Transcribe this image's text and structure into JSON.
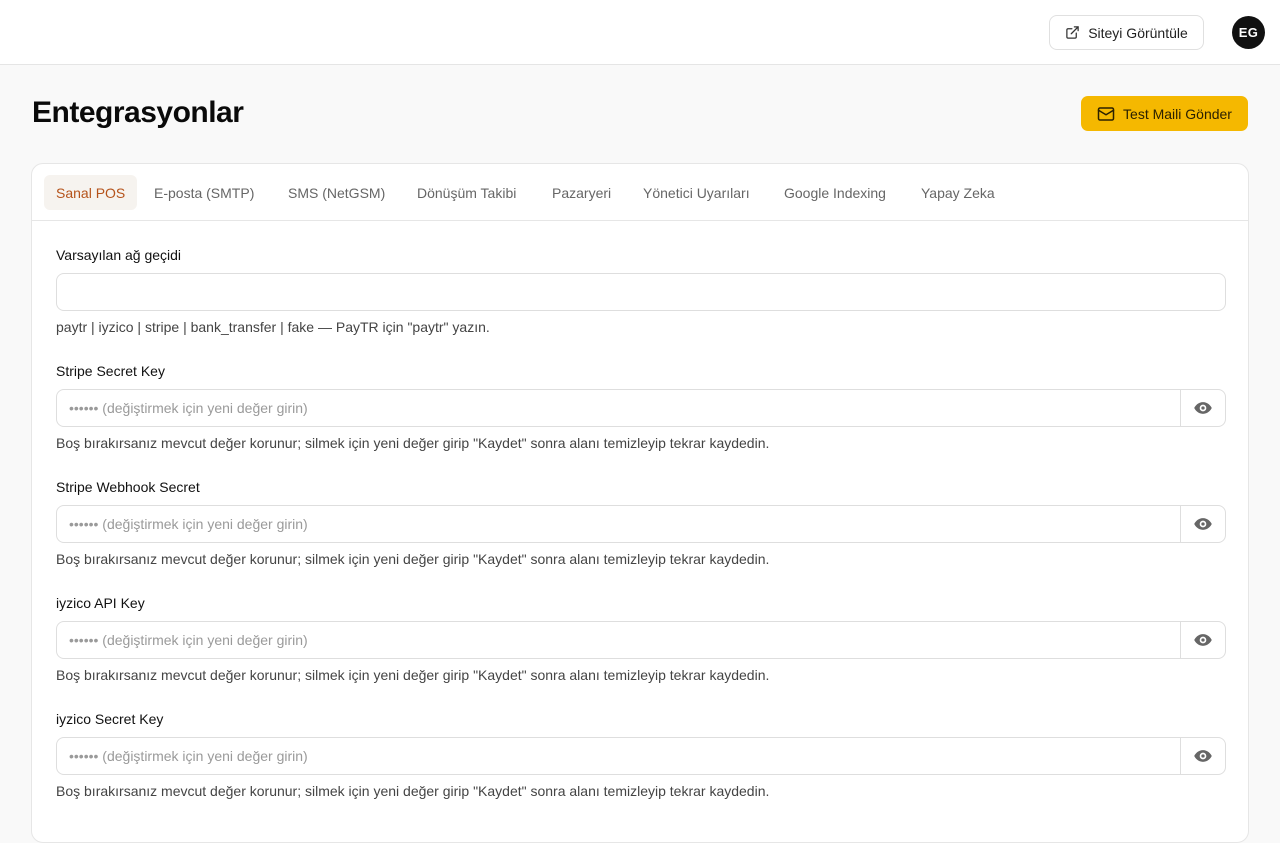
{
  "header": {
    "view_site_label": "Siteyi Görüntüle",
    "avatar_initials": "EG"
  },
  "page": {
    "title": "Entegrasyonlar",
    "test_mail_label": "Test Maili Gönder"
  },
  "tabs": [
    {
      "label": "Sanal POS",
      "active": true
    },
    {
      "label": "E-posta (SMTP)"
    },
    {
      "label": "SMS (NetGSM)"
    },
    {
      "label": "Dönüşüm Takibi"
    },
    {
      "label": "Pazaryeri"
    },
    {
      "label": "Yönetici Uyarıları"
    },
    {
      "label": "Google Indexing"
    },
    {
      "label": "Yapay Zeka"
    }
  ],
  "form": {
    "gateway": {
      "label": "Varsayılan ağ geçidi",
      "value": "",
      "hint": "paytr | iyzico | stripe | bank_transfer | fake — PayTR için \"paytr\" yazın."
    },
    "secrets": [
      {
        "label": "Stripe Secret Key",
        "placeholder": "•••••• (değiştirmek için yeni değer girin)",
        "hint": "Boş bırakırsanız mevcut değer korunur; silmek için yeni değer girip \"Kaydet\" sonra alanı temizleyip tekrar kaydedin."
      },
      {
        "label": "Stripe Webhook Secret",
        "placeholder": "•••••• (değiştirmek için yeni değer girin)",
        "hint": "Boş bırakırsanız mevcut değer korunur; silmek için yeni değer girip \"Kaydet\" sonra alanı temizleyip tekrar kaydedin."
      },
      {
        "label": "iyzico API Key",
        "placeholder": "•••••• (değiştirmek için yeni değer girin)",
        "hint": "Boş bırakırsanız mevcut değer korunur; silmek için yeni değer girip \"Kaydet\" sonra alanı temizleyip tekrar kaydedin."
      },
      {
        "label": "iyzico Secret Key",
        "placeholder": "•••••• (değiştirmek için yeni değer girin)",
        "hint": "Boş bırakırsanız mevcut değer korunur; silmek için yeni değer girip \"Kaydet\" sonra alanı temizleyip tekrar kaydedin."
      }
    ]
  },
  "colors": {
    "accent": "#f5b800",
    "active_tab_text": "#b5531b",
    "active_tab_bg": "#f6f3ef"
  },
  "icons": {
    "view_site": "external-link-icon",
    "test_mail": "mail-icon",
    "reveal": "eye-icon"
  }
}
